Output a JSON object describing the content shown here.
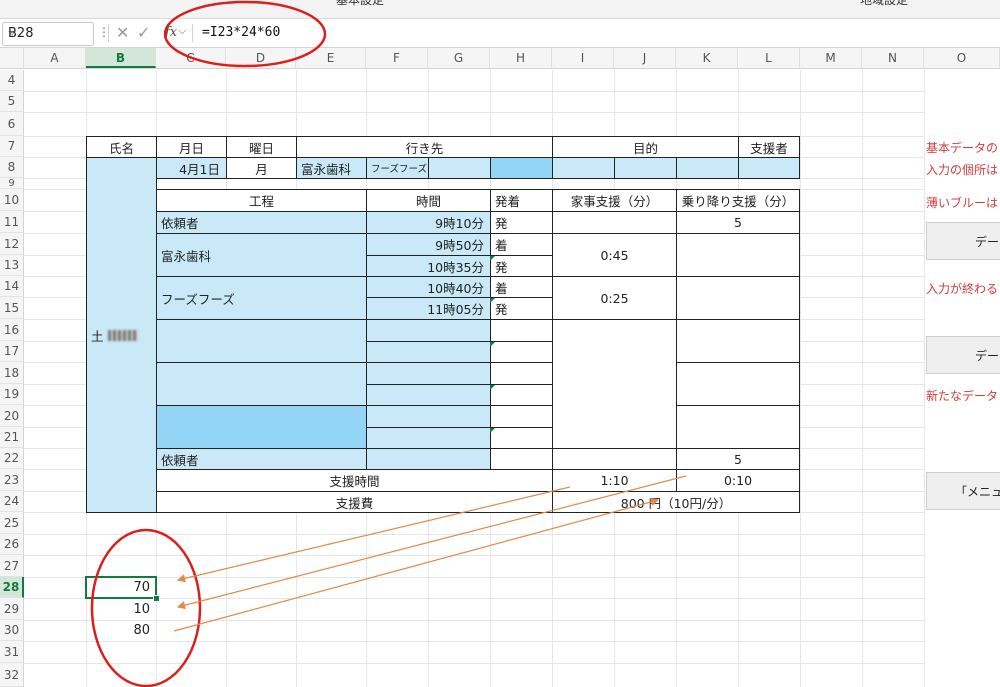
{
  "top_strip": {
    "left_peek": "基本設定",
    "right_peek": "地域設定"
  },
  "formula_bar": {
    "name_box": "B28",
    "fx": "fx",
    "formula": "=I23*24*60"
  },
  "columns": [
    "A",
    "B",
    "C",
    "D",
    "E",
    "F",
    "G",
    "H",
    "I",
    "J",
    "K",
    "L",
    "M",
    "N",
    "O"
  ],
  "selected_column": "B",
  "rows": [
    "4",
    "5",
    "6",
    "7",
    "8",
    "9",
    "10",
    "11",
    "12",
    "13",
    "14",
    "15",
    "16",
    "17",
    "18",
    "19",
    "20",
    "21",
    "22",
    "23",
    "24",
    "25",
    "26",
    "27",
    "28",
    "29",
    "30",
    "31",
    "32"
  ],
  "selected_row": "28",
  "form": {
    "header": {
      "name": "氏名",
      "date": "月日",
      "weekday": "曜日",
      "destination": "行き先",
      "purpose": "目的",
      "supporter": "支援者"
    },
    "row8": {
      "date": "4月1日",
      "weekday": "月",
      "destination": "富永歯科",
      "destination2": "フーズフーズ"
    },
    "person_name": "土",
    "table_header": {
      "process": "工程",
      "time": "時間",
      "arr_dep": "発着",
      "housework": "家事支援（分）",
      "ride": "乗り降り支援（分）"
    },
    "rows": [
      {
        "process": "依頼者",
        "time": "9時10分",
        "ad": "発",
        "housework": "",
        "ride": "5"
      },
      {
        "process": "富永歯科",
        "time1": "9時50分",
        "ad1": "着",
        "time2": "10時35分",
        "ad2": "発",
        "housework": "0:45"
      },
      {
        "process": "フーズフーズ",
        "time1": "10時40分",
        "ad1": "着",
        "time2": "11時05分",
        "ad2": "発",
        "housework": "0:25"
      },
      {
        "process": "依頼者",
        "ride": "5"
      }
    ],
    "support_time": {
      "label": "支援時間",
      "housework": "1:10",
      "ride": "0:10"
    },
    "support_fee": {
      "label": "支援費",
      "value": "800 円（10円/分）"
    }
  },
  "result_cells": {
    "b28": "70",
    "b29": "10",
    "b30": "80"
  },
  "right_panel": {
    "note1": "基本データの",
    "note2": "入力の個所は",
    "note3": "薄いブルーは",
    "button1": "デー",
    "note4": "入力が終わる",
    "button2": "デー",
    "note5": "新たなデータ",
    "button3": "「メニュ"
  },
  "colors": {
    "light_blue": "#c9e9f8",
    "dark_blue": "#94d5f5",
    "selection_green": "#107c41",
    "annotation_red": "#d9201c",
    "arrow_orange": "#e08a4c",
    "note_red": "#d23c3c"
  }
}
